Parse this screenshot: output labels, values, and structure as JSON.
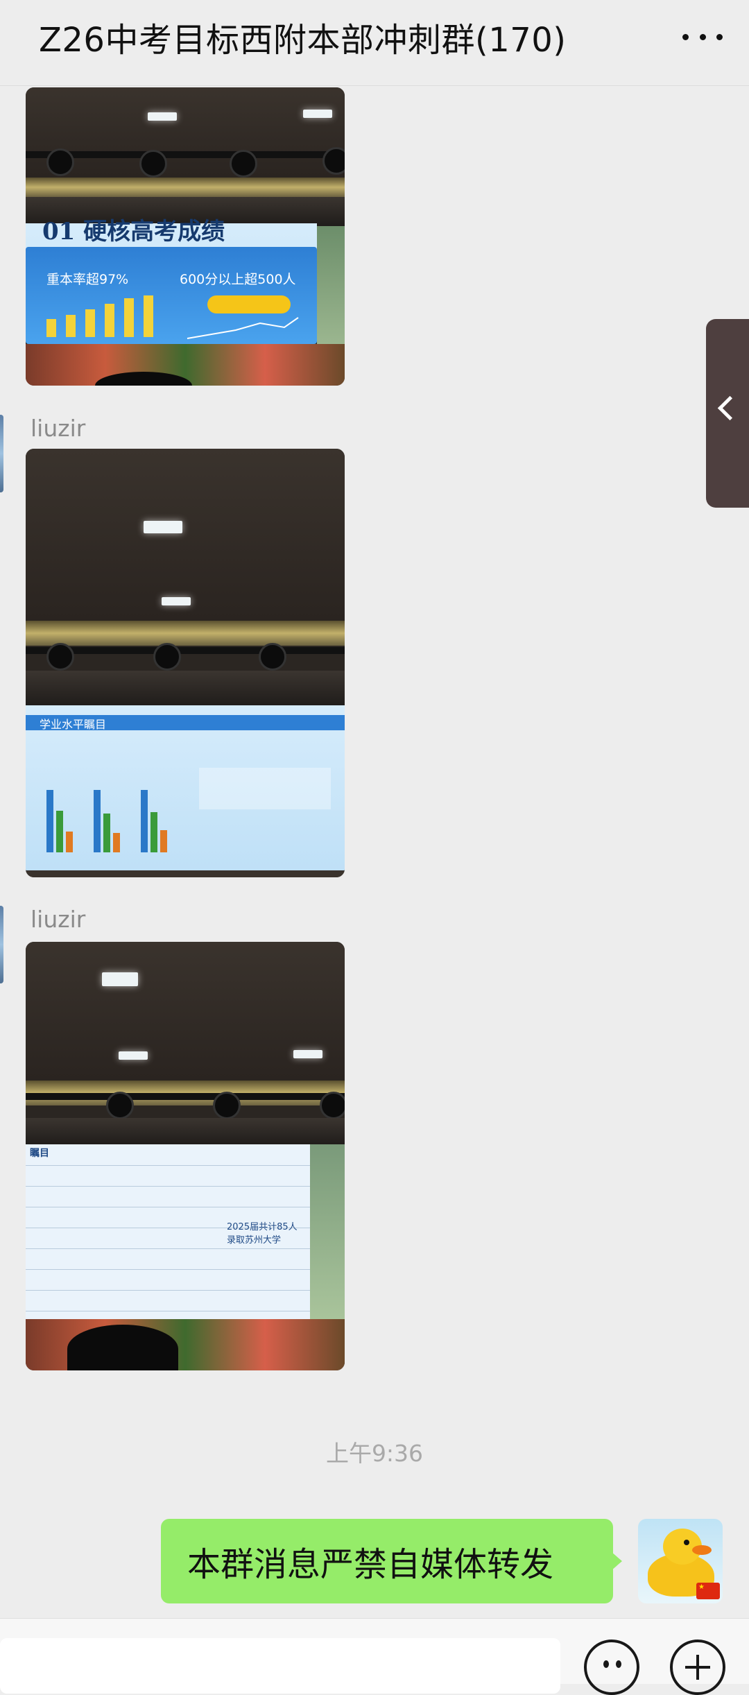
{
  "header": {
    "title": "Z26中考目标西附本部冲刺群(170)"
  },
  "messages": [
    {
      "type": "image",
      "sender": "",
      "slide": {
        "heading": "01  硬核高考成绩",
        "stat1": "重本率超97%",
        "stat2": "600分以上超500人"
      }
    },
    {
      "type": "image",
      "sender": "liuzir",
      "slide": {
        "heading": "学业水平瞩目"
      }
    },
    {
      "type": "image",
      "sender": "liuzir",
      "slide": {
        "heading": "瞩目",
        "caption": "2025届共计85人录取苏州大学"
      }
    }
  ],
  "timestamp": "上午9:36",
  "my_message": {
    "text": "本群消息严禁自媒体转发"
  },
  "icons": [
    "more-icon",
    "chevron-left-icon",
    "emoji-icon",
    "plus-icon",
    "avatar-duck"
  ],
  "colors": {
    "bubble_green": "#95ec69",
    "background": "#ededed"
  }
}
